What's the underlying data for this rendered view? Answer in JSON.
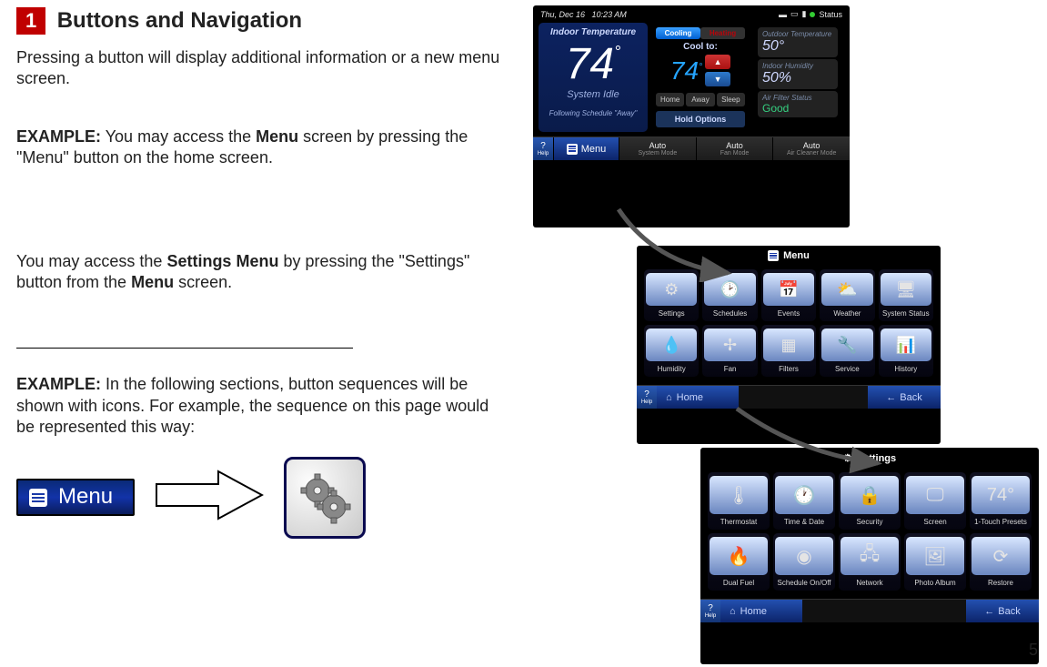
{
  "section": {
    "number": "1",
    "title": "Buttons and Navigation"
  },
  "intro": "Pressing a button will display additional information or a new menu screen.",
  "example1_label": "EXAMPLE:",
  "example1_text": " You may access the Menu screen by pressing the \"Menu\" button on the home screen.",
  "example1_bold_hint": "Menu",
  "para2_pre": "You may access the ",
  "para2_bold1": "Settings Menu",
  "para2_mid": " by pressing the \"Settings\" button from the ",
  "para2_bold2": "Menu",
  "para2_post": " screen.",
  "example2_label": "EXAMPLE:",
  "example2_text": " In the following sections, button sequences will be shown with icons. For example, the sequence on this page would be represented this way:",
  "menu_button_label": "Menu",
  "page_number": "5",
  "thermo1": {
    "date": "Thu, Dec 16",
    "time": "10:23 AM",
    "status": "Status",
    "indoor_label": "Indoor Temperature",
    "indoor_temp": "74",
    "system_state": "System Idle",
    "follow_text": "Following Schedule \"Away\"",
    "cooling": "Cooling",
    "heating": "Heating",
    "cool_to_label": "Cool to:",
    "cool_to_temp": "74",
    "preset_home": "Home",
    "preset_away": "Away",
    "preset_sleep": "Sleep",
    "hold_options": "Hold Options",
    "out_temp_label": "Outdoor Temperature",
    "out_temp": "50°",
    "humidity_label": "Indoor Humidity",
    "humidity": "50%",
    "air_filter_label": "Air Filter Status",
    "air_filter_status": "Good",
    "help": "?",
    "help_sub": "Help",
    "menu": "Menu",
    "sys_mode": "Auto",
    "sys_mode_sub": "System Mode",
    "fan_mode": "Auto",
    "fan_mode_sub": "Fan Mode",
    "air_mode": "Auto",
    "air_mode_sub": "Air Cleaner Mode"
  },
  "thermo2": {
    "title": "Menu",
    "items": [
      {
        "icon": "⚙",
        "label": "Settings"
      },
      {
        "icon": "🕑",
        "label": "Schedules"
      },
      {
        "icon": "📅",
        "label": "Events"
      },
      {
        "icon": "⛅",
        "label": "Weather"
      },
      {
        "icon": "🖥",
        "label": "System Status"
      },
      {
        "icon": "💧",
        "label": "Humidity"
      },
      {
        "icon": "✢",
        "label": "Fan"
      },
      {
        "icon": "▦",
        "label": "Filters"
      },
      {
        "icon": "🔧",
        "label": "Service"
      },
      {
        "icon": "📊",
        "label": "History"
      }
    ],
    "home": "Home",
    "back": "Back"
  },
  "thermo3": {
    "title": "Settings",
    "items": [
      {
        "icon": "🌡",
        "label": "Thermostat"
      },
      {
        "icon": "🕐",
        "label": "Time & Date"
      },
      {
        "icon": "🔒",
        "label": "Security"
      },
      {
        "icon": "🖵",
        "label": "Screen"
      },
      {
        "icon": "74°",
        "label": "1-Touch Presets"
      },
      {
        "icon": "🔥",
        "label": "Dual Fuel"
      },
      {
        "icon": "◉",
        "label": "Schedule On/Off"
      },
      {
        "icon": "🖧",
        "label": "Network"
      },
      {
        "icon": "🖼",
        "label": "Photo Album"
      },
      {
        "icon": "⟳",
        "label": "Restore"
      }
    ],
    "home": "Home",
    "back": "Back"
  }
}
